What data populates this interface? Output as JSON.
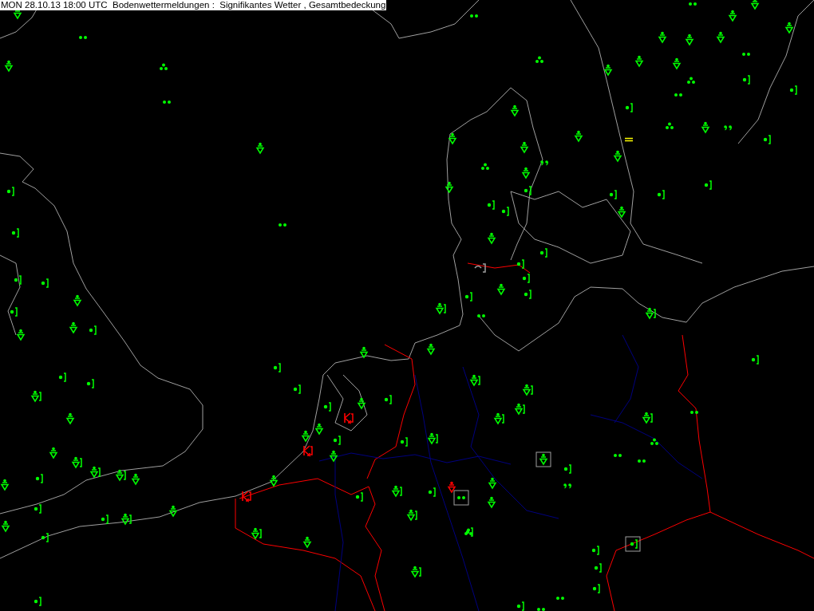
{
  "title": "MON 28.10.13 18:00 UTC  Bodenwettermeldungen :  Signifikantes Wetter , Gesamtbedeckung"
}
